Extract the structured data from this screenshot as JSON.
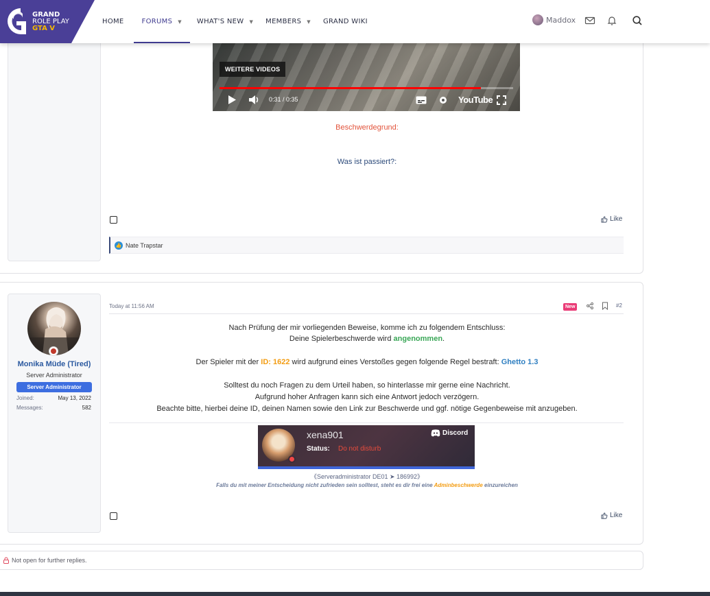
{
  "logo": {
    "line1": "GRAND",
    "line2": "ROLE PLAY",
    "line3": "GTA V"
  },
  "nav": {
    "items": [
      {
        "label": "HOME",
        "has_caret": false,
        "active": false
      },
      {
        "label": "FORUMS",
        "has_caret": true,
        "active": true
      },
      {
        "label": "WHAT'S NEW",
        "has_caret": true,
        "active": false
      },
      {
        "label": "MEMBERS",
        "has_caret": true,
        "active": false
      },
      {
        "label": "GRAND WIKI",
        "has_caret": false,
        "active": false
      }
    ],
    "username": "Maddox"
  },
  "video": {
    "more_videos": "WEITERE VIDEOS",
    "time": "0:31 / 0:35",
    "brand": "YouTube",
    "progress_fraction": 0.89
  },
  "post1": {
    "reason_label": "Beschwerdegrund:",
    "what_happened": "Was ist passiert?:",
    "like_label": "Like",
    "reaction_user": "Nate Trapstar"
  },
  "post2": {
    "user": {
      "name": "Monika Müde (Tired)",
      "title": "Server Administrator",
      "banner": "Server Administrator",
      "joined_label": "Joined:",
      "joined_value": "May 13, 2022",
      "messages_label": "Messages:",
      "messages_value": "582"
    },
    "timestamp": "Today at 11:56 AM",
    "new_badge": "New",
    "post_number": "#2",
    "line1": "Nach Prüfung der mir vorliegenden Beweise, komme ich zu folgendem Entschluss:",
    "line2_prefix": "Deine Spielerbeschwerde wird ",
    "line2_verdict": "angenommen",
    "line2_suffix": ".",
    "line3_prefix": "Der Spieler mit der ",
    "line3_id": "ID: 1622",
    "line3_mid": " wird aufgrund eines Verstoßes gegen folgende Regel bestraft: ",
    "line3_rule": "Ghetto 1.3",
    "line4": "Solltest du noch Fragen zu dem Urteil haben, so hinterlasse mir gerne eine Nachricht.",
    "line5": "Aufgrund hoher Anfragen kann sich eine Antwort jedoch verzögern.",
    "line6": "Beachte bitte, hierbei deine ID, deinen Namen sowie den Link zur Beschwerde und ggf. nötige Gegenbeweise mit anzugeben.",
    "discord": {
      "name": "xena901",
      "status_label": "Status:",
      "status_value": "Do not disturb",
      "brand": "Discord"
    },
    "sig_line": "《Serveradministrator DE01 ➤ 186992》",
    "appeal_prefix": "Falls du mit meiner Entscheidung nicht zufrieden sein solltest, steht es dir frei eine ",
    "appeal_link": "Adminbeschwerde",
    "appeal_suffix": " einzureichen",
    "like_label": "Like"
  },
  "closed_notice": "Not open for further replies.",
  "colors": {
    "brand_purple": "#3f3b8f",
    "accent_orange": "#f39c12",
    "verdict_green": "#3aa757",
    "rule_blue": "#2f7fc1",
    "reason_red": "#e2533b",
    "name_blue": "#2c5aa0"
  }
}
